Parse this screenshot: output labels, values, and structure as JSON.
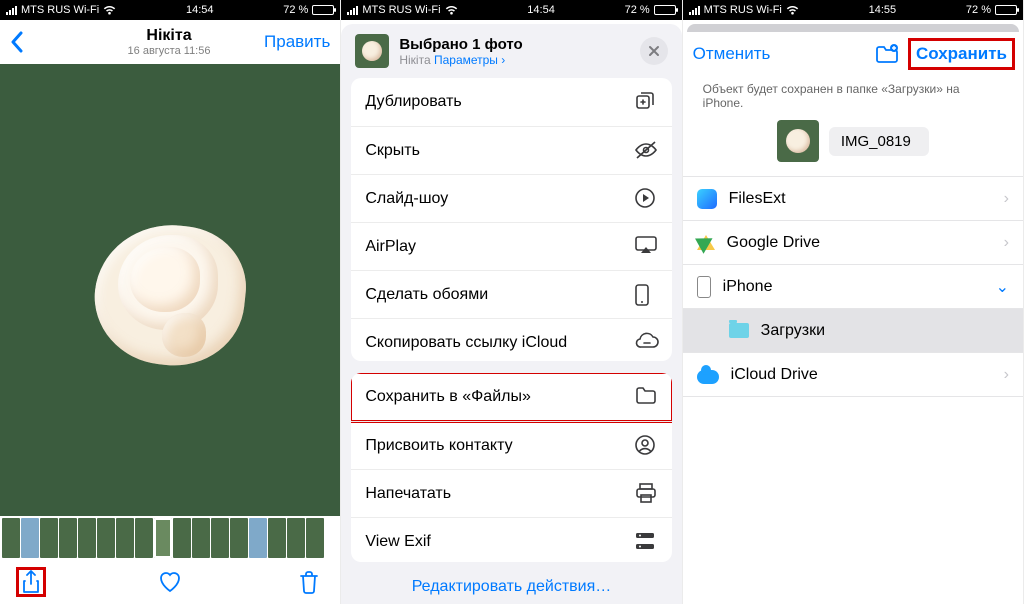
{
  "status": {
    "carrier": "MTS RUS Wi-Fi",
    "time1": "14:54",
    "time2": "14:54",
    "time3": "14:55",
    "battery_pct": "72 %"
  },
  "panel1": {
    "title": "Нікіта",
    "subtitle": "16 августа  11:56",
    "edit": "Править"
  },
  "panel2": {
    "header_title": "Выбрано 1 фото",
    "header_from": "Нікіта",
    "header_options": "Параметры",
    "group1": [
      {
        "label": "Дублировать",
        "icon": "dup"
      },
      {
        "label": "Скрыть",
        "icon": "hide"
      },
      {
        "label": "Слайд-шоу",
        "icon": "play"
      },
      {
        "label": "AirPlay",
        "icon": "airplay"
      },
      {
        "label": "Сделать обоями",
        "icon": "phone"
      },
      {
        "label": "Скопировать ссылку iCloud",
        "icon": "link"
      }
    ],
    "group2": [
      {
        "label": "Сохранить в «Файлы»",
        "icon": "folder",
        "red": true
      },
      {
        "label": "Присвоить контакту",
        "icon": "contact"
      },
      {
        "label": "Напечатать",
        "icon": "print"
      },
      {
        "label": "View Exif",
        "icon": "exif"
      }
    ],
    "edit_actions": "Редактировать действия…"
  },
  "panel3": {
    "cancel": "Отменить",
    "save": "Сохранить",
    "notice": "Объект будет сохранен в папке «Загрузки» на iPhone.",
    "filename": "IMG_0819",
    "locations": [
      {
        "label": "FilesExt",
        "icon": "filesext",
        "kind": "top"
      },
      {
        "label": "Google Drive",
        "icon": "gdrive",
        "kind": "top"
      },
      {
        "label": "iPhone",
        "icon": "iphone",
        "kind": "expand"
      },
      {
        "label": "Загрузки",
        "icon": "dlfolder",
        "kind": "sub",
        "selected": true
      },
      {
        "label": "iCloud Drive",
        "icon": "icloud",
        "kind": "top"
      }
    ]
  }
}
